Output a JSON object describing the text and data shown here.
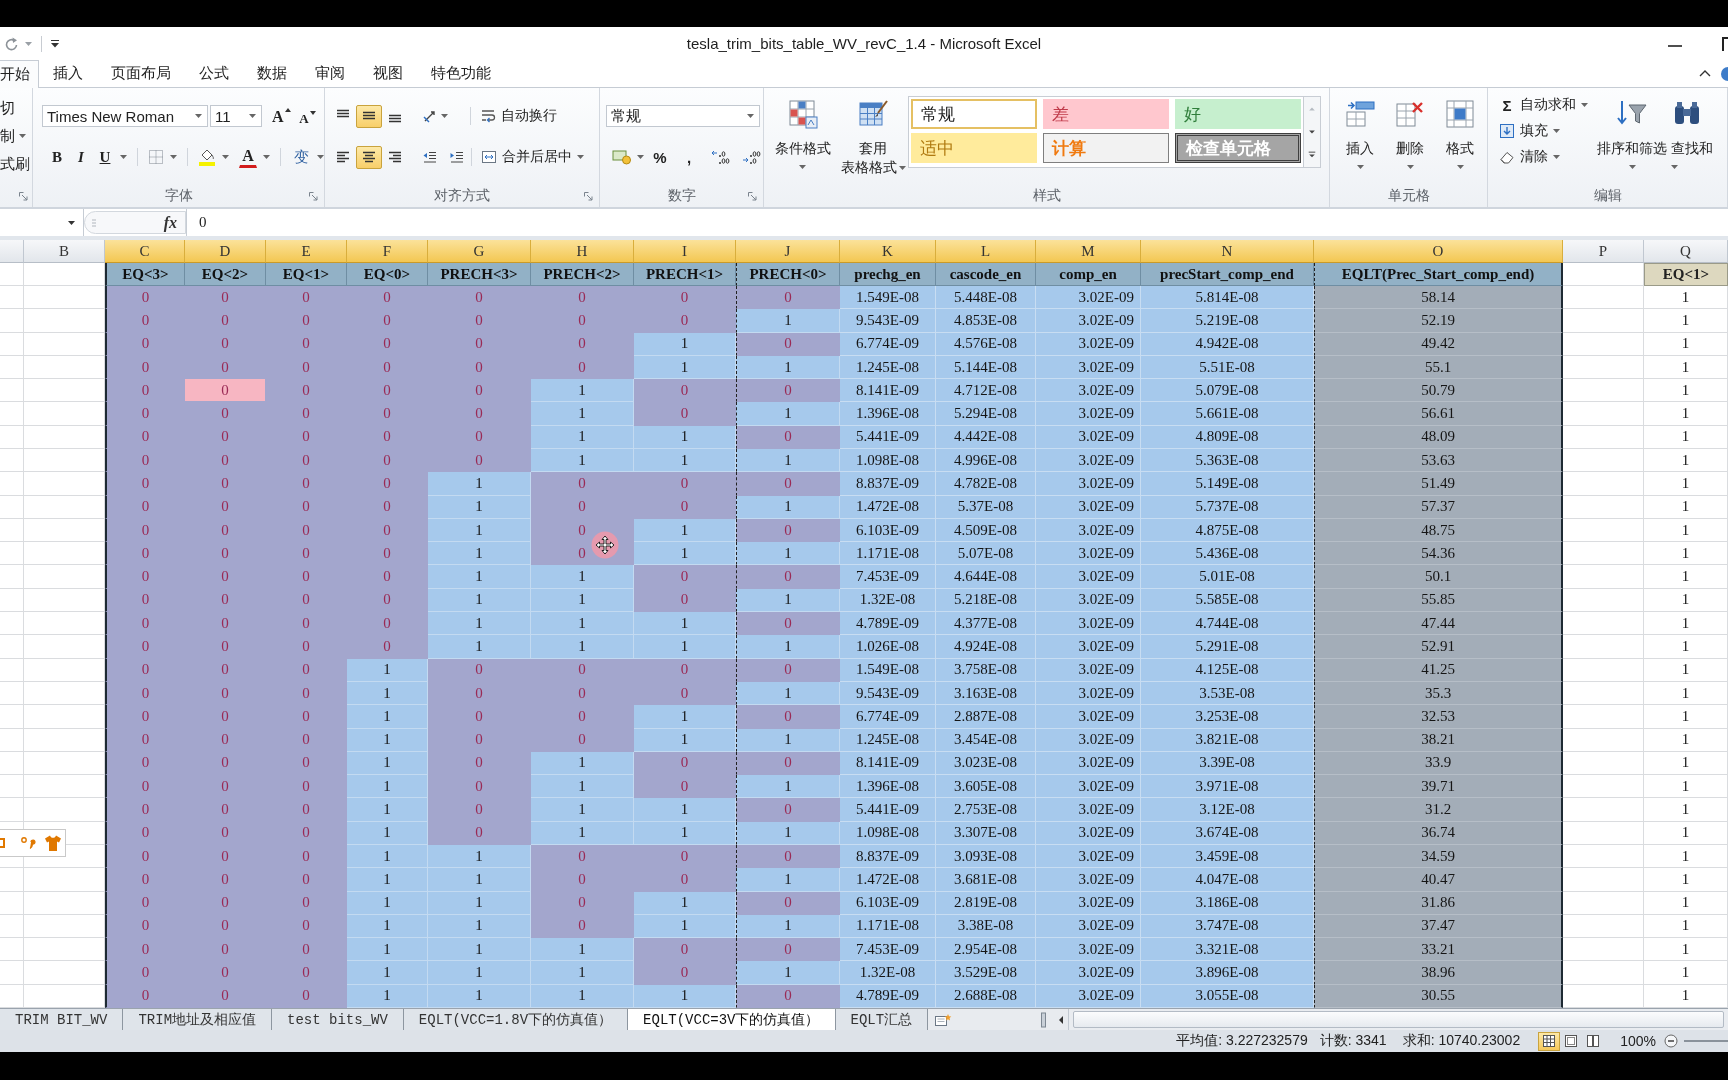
{
  "title_bar": {
    "title": "tesla_trim_bits_table_WV_revC_1.4 - Microsoft Excel"
  },
  "ribbon_tabs": [
    {
      "label": "开始",
      "selected": true
    },
    {
      "label": "插入",
      "selected": false
    },
    {
      "label": "页面布局",
      "selected": false
    },
    {
      "label": "公式",
      "selected": false
    },
    {
      "label": "数据",
      "selected": false
    },
    {
      "label": "审阅",
      "selected": false
    },
    {
      "label": "视图",
      "selected": false
    },
    {
      "label": "特色功能",
      "selected": false
    }
  ],
  "clipboard": {
    "items": [
      "切",
      "制",
      "式刷"
    ]
  },
  "font_group": {
    "font": "Times New Roman",
    "size": "11",
    "grow": "A",
    "shrink": "A",
    "style_buttons": [
      "B",
      "I",
      "U"
    ],
    "color_glyph": "A",
    "phonetic": "变",
    "label": "字体"
  },
  "alignment_group": {
    "vertical": [
      {
        "kind": "top",
        "selected": false
      },
      {
        "kind": "middle",
        "selected": true
      },
      {
        "kind": "bottom",
        "selected": false
      }
    ],
    "horizontal": [
      {
        "kind": "left",
        "selected": false
      },
      {
        "kind": "center",
        "selected": true
      },
      {
        "kind": "right",
        "selected": false
      }
    ],
    "wrap": "自动换行",
    "merge": "合并后居中",
    "label": "对齐方式"
  },
  "number_group": {
    "format": "常规",
    "percent": "%",
    "comma": ",",
    "label": "数字"
  },
  "styles_group": {
    "conditional": "条件格式",
    "table_format": [
      "套用",
      "表格格式"
    ],
    "gallery": [
      {
        "text": "常规",
        "kind": "normal",
        "selected": true
      },
      {
        "text": "差",
        "kind": "bad",
        "selected": false
      },
      {
        "text": "好",
        "kind": "good",
        "selected": false
      },
      {
        "text": "适中",
        "kind": "neutral",
        "selected": false
      },
      {
        "text": "计算",
        "kind": "calculation",
        "selected": false
      },
      {
        "text": "检查单元格",
        "kind": "check",
        "selected": false
      }
    ],
    "label": "样式"
  },
  "cells_group": {
    "buttons": [
      {
        "kind": "insert",
        "label": "插入"
      },
      {
        "kind": "delete",
        "label": "删除"
      },
      {
        "kind": "format",
        "label": "格式"
      }
    ],
    "label": "单元格"
  },
  "editing_group": {
    "autosum": {
      "symbol": "Σ",
      "label": "自动求和"
    },
    "fill": "填充",
    "clear": "清除",
    "sort": "排序和筛选",
    "find": "查找和",
    "label": "编辑"
  },
  "formula_bar": {
    "function_label": "fx",
    "value": "0"
  },
  "sheet": {
    "columns": [
      {
        "letter": "B",
        "selected": false
      },
      {
        "letter": "C",
        "selected": true
      },
      {
        "letter": "D",
        "selected": true
      },
      {
        "letter": "E",
        "selected": true
      },
      {
        "letter": "F",
        "selected": true
      },
      {
        "letter": "G",
        "selected": true
      },
      {
        "letter": "H",
        "selected": true
      },
      {
        "letter": "I",
        "selected": true
      },
      {
        "letter": "J",
        "selected": true
      },
      {
        "letter": "K",
        "selected": true
      },
      {
        "letter": "L",
        "selected": true
      },
      {
        "letter": "M",
        "selected": true
      },
      {
        "letter": "N",
        "selected": true
      },
      {
        "letter": "O",
        "selected": true
      },
      {
        "letter": "P",
        "selected": false
      },
      {
        "letter": "Q",
        "selected": false
      }
    ],
    "header": [
      "EQ<3>",
      "EQ<2>",
      "EQ<1>",
      "EQ<0>",
      "PRECH<3>",
      "PRECH<2>",
      "PRECH<1>",
      "PRECH<0>",
      "prechg_en",
      "cascode_en",
      "comp_en",
      "precStart_comp_end",
      "EQLT(Prec_Start_comp_end)"
    ],
    "q_header": "EQ<1>",
    "rows": [
      {
        "bits": [
          {
            "text": "0",
            "on": false
          },
          {
            "text": "0",
            "on": false
          },
          {
            "text": "0",
            "on": false
          },
          {
            "text": "0",
            "on": false
          },
          {
            "text": "0",
            "on": false
          },
          {
            "text": "0",
            "on": false
          },
          {
            "text": "0",
            "on": false
          },
          {
            "text": "0",
            "on": false
          }
        ],
        "measures": [
          "1.549E-08",
          "5.448E-08",
          "3.02E-09",
          "5.814E-08"
        ],
        "eqlt": "58.14",
        "q": "1"
      },
      {
        "bits": [
          {
            "text": "0",
            "on": false
          },
          {
            "text": "0",
            "on": false
          },
          {
            "text": "0",
            "on": false
          },
          {
            "text": "0",
            "on": false
          },
          {
            "text": "0",
            "on": false
          },
          {
            "text": "0",
            "on": false
          },
          {
            "text": "0",
            "on": false
          },
          {
            "text": "1",
            "on": true
          }
        ],
        "measures": [
          "9.543E-09",
          "4.853E-08",
          "3.02E-09",
          "5.219E-08"
        ],
        "eqlt": "52.19",
        "q": "1"
      },
      {
        "bits": [
          {
            "text": "0",
            "on": false
          },
          {
            "text": "0",
            "on": false
          },
          {
            "text": "0",
            "on": false
          },
          {
            "text": "0",
            "on": false
          },
          {
            "text": "0",
            "on": false
          },
          {
            "text": "0",
            "on": false
          },
          {
            "text": "1",
            "on": true
          },
          {
            "text": "0",
            "on": false
          }
        ],
        "measures": [
          "6.774E-09",
          "4.576E-08",
          "3.02E-09",
          "4.942E-08"
        ],
        "eqlt": "49.42",
        "q": "1"
      },
      {
        "bits": [
          {
            "text": "0",
            "on": false
          },
          {
            "text": "0",
            "on": false
          },
          {
            "text": "0",
            "on": false
          },
          {
            "text": "0",
            "on": false
          },
          {
            "text": "0",
            "on": false
          },
          {
            "text": "0",
            "on": false
          },
          {
            "text": "1",
            "on": true
          },
          {
            "text": "1",
            "on": true
          }
        ],
        "measures": [
          "1.245E-08",
          "5.144E-08",
          "3.02E-09",
          "5.51E-08"
        ],
        "eqlt": "55.1",
        "q": "1"
      },
      {
        "bits": [
          {
            "text": "0",
            "on": false
          },
          {
            "text": "0",
            "on": false,
            "color": "#f7b6c2"
          },
          {
            "text": "0",
            "on": false
          },
          {
            "text": "0",
            "on": false
          },
          {
            "text": "0",
            "on": false
          },
          {
            "text": "1",
            "on": true
          },
          {
            "text": "0",
            "on": false
          },
          {
            "text": "0",
            "on": false
          }
        ],
        "measures": [
          "8.141E-09",
          "4.712E-08",
          "3.02E-09",
          "5.079E-08"
        ],
        "eqlt": "50.79",
        "q": "1"
      },
      {
        "bits": [
          {
            "text": "0",
            "on": false
          },
          {
            "text": "0",
            "on": false
          },
          {
            "text": "0",
            "on": false
          },
          {
            "text": "0",
            "on": false
          },
          {
            "text": "0",
            "on": false
          },
          {
            "text": "1",
            "on": true
          },
          {
            "text": "0",
            "on": false
          },
          {
            "text": "1",
            "on": true
          }
        ],
        "measures": [
          "1.396E-08",
          "5.294E-08",
          "3.02E-09",
          "5.661E-08"
        ],
        "eqlt": "56.61",
        "q": "1"
      },
      {
        "bits": [
          {
            "text": "0",
            "on": false
          },
          {
            "text": "0",
            "on": false
          },
          {
            "text": "0",
            "on": false
          },
          {
            "text": "0",
            "on": false
          },
          {
            "text": "0",
            "on": false
          },
          {
            "text": "1",
            "on": true
          },
          {
            "text": "1",
            "on": true
          },
          {
            "text": "0",
            "on": false
          }
        ],
        "measures": [
          "5.441E-09",
          "4.442E-08",
          "3.02E-09",
          "4.809E-08"
        ],
        "eqlt": "48.09",
        "q": "1"
      },
      {
        "bits": [
          {
            "text": "0",
            "on": false
          },
          {
            "text": "0",
            "on": false
          },
          {
            "text": "0",
            "on": false
          },
          {
            "text": "0",
            "on": false
          },
          {
            "text": "0",
            "on": false
          },
          {
            "text": "1",
            "on": true
          },
          {
            "text": "1",
            "on": true
          },
          {
            "text": "1",
            "on": true
          }
        ],
        "measures": [
          "1.098E-08",
          "4.996E-08",
          "3.02E-09",
          "5.363E-08"
        ],
        "eqlt": "53.63",
        "q": "1"
      },
      {
        "bits": [
          {
            "text": "0",
            "on": false
          },
          {
            "text": "0",
            "on": false
          },
          {
            "text": "0",
            "on": false
          },
          {
            "text": "0",
            "on": false
          },
          {
            "text": "1",
            "on": true
          },
          {
            "text": "0",
            "on": false
          },
          {
            "text": "0",
            "on": false
          },
          {
            "text": "0",
            "on": false
          }
        ],
        "measures": [
          "8.837E-09",
          "4.782E-08",
          "3.02E-09",
          "5.149E-08"
        ],
        "eqlt": "51.49",
        "q": "1"
      },
      {
        "bits": [
          {
            "text": "0",
            "on": false
          },
          {
            "text": "0",
            "on": false
          },
          {
            "text": "0",
            "on": false
          },
          {
            "text": "0",
            "on": false
          },
          {
            "text": "1",
            "on": true
          },
          {
            "text": "0",
            "on": false
          },
          {
            "text": "0",
            "on": false
          },
          {
            "text": "1",
            "on": true
          }
        ],
        "measures": [
          "1.472E-08",
          "5.37E-08",
          "3.02E-09",
          "5.737E-08"
        ],
        "eqlt": "57.37",
        "q": "1"
      },
      {
        "bits": [
          {
            "text": "0",
            "on": false
          },
          {
            "text": "0",
            "on": false
          },
          {
            "text": "0",
            "on": false
          },
          {
            "text": "0",
            "on": false
          },
          {
            "text": "1",
            "on": true
          },
          {
            "text": "0",
            "on": false
          },
          {
            "text": "1",
            "on": true
          },
          {
            "text": "0",
            "on": false
          }
        ],
        "measures": [
          "6.103E-09",
          "4.509E-08",
          "3.02E-09",
          "4.875E-08"
        ],
        "eqlt": "48.75",
        "q": "1"
      },
      {
        "bits": [
          {
            "text": "0",
            "on": false
          },
          {
            "text": "0",
            "on": false
          },
          {
            "text": "0",
            "on": false
          },
          {
            "text": "0",
            "on": false
          },
          {
            "text": "1",
            "on": true
          },
          {
            "text": "0",
            "on": false
          },
          {
            "text": "1",
            "on": true
          },
          {
            "text": "1",
            "on": true
          }
        ],
        "measures": [
          "1.171E-08",
          "5.07E-08",
          "3.02E-09",
          "5.436E-08"
        ],
        "eqlt": "54.36",
        "q": "1"
      },
      {
        "bits": [
          {
            "text": "0",
            "on": false
          },
          {
            "text": "0",
            "on": false
          },
          {
            "text": "0",
            "on": false
          },
          {
            "text": "0",
            "on": false
          },
          {
            "text": "1",
            "on": true
          },
          {
            "text": "1",
            "on": true
          },
          {
            "text": "0",
            "on": false
          },
          {
            "text": "0",
            "on": false
          }
        ],
        "measures": [
          "7.453E-09",
          "4.644E-08",
          "3.02E-09",
          "5.01E-08"
        ],
        "eqlt": "50.1",
        "q": "1"
      },
      {
        "bits": [
          {
            "text": "0",
            "on": false
          },
          {
            "text": "0",
            "on": false
          },
          {
            "text": "0",
            "on": false
          },
          {
            "text": "0",
            "on": false
          },
          {
            "text": "1",
            "on": true
          },
          {
            "text": "1",
            "on": true
          },
          {
            "text": "0",
            "on": false
          },
          {
            "text": "1",
            "on": true
          }
        ],
        "measures": [
          "1.32E-08",
          "5.218E-08",
          "3.02E-09",
          "5.585E-08"
        ],
        "eqlt": "55.85",
        "q": "1"
      },
      {
        "bits": [
          {
            "text": "0",
            "on": false
          },
          {
            "text": "0",
            "on": false
          },
          {
            "text": "0",
            "on": false
          },
          {
            "text": "0",
            "on": false
          },
          {
            "text": "1",
            "on": true
          },
          {
            "text": "1",
            "on": true
          },
          {
            "text": "1",
            "on": true
          },
          {
            "text": "0",
            "on": false
          }
        ],
        "measures": [
          "4.789E-09",
          "4.377E-08",
          "3.02E-09",
          "4.744E-08"
        ],
        "eqlt": "47.44",
        "q": "1"
      },
      {
        "bits": [
          {
            "text": "0",
            "on": false
          },
          {
            "text": "0",
            "on": false
          },
          {
            "text": "0",
            "on": false
          },
          {
            "text": "0",
            "on": false
          },
          {
            "text": "1",
            "on": true
          },
          {
            "text": "1",
            "on": true
          },
          {
            "text": "1",
            "on": true
          },
          {
            "text": "1",
            "on": true
          }
        ],
        "measures": [
          "1.026E-08",
          "4.924E-08",
          "3.02E-09",
          "5.291E-08"
        ],
        "eqlt": "52.91",
        "q": "1"
      },
      {
        "bits": [
          {
            "text": "0",
            "on": false
          },
          {
            "text": "0",
            "on": false
          },
          {
            "text": "0",
            "on": false
          },
          {
            "text": "1",
            "on": true
          },
          {
            "text": "0",
            "on": false
          },
          {
            "text": "0",
            "on": false
          },
          {
            "text": "0",
            "on": false
          },
          {
            "text": "0",
            "on": false
          }
        ],
        "measures": [
          "1.549E-08",
          "3.758E-08",
          "3.02E-09",
          "4.125E-08"
        ],
        "eqlt": "41.25",
        "q": "1"
      },
      {
        "bits": [
          {
            "text": "0",
            "on": false
          },
          {
            "text": "0",
            "on": false
          },
          {
            "text": "0",
            "on": false
          },
          {
            "text": "1",
            "on": true
          },
          {
            "text": "0",
            "on": false
          },
          {
            "text": "0",
            "on": false
          },
          {
            "text": "0",
            "on": false
          },
          {
            "text": "1",
            "on": true
          }
        ],
        "measures": [
          "9.543E-09",
          "3.163E-08",
          "3.02E-09",
          "3.53E-08"
        ],
        "eqlt": "35.3",
        "q": "1"
      },
      {
        "bits": [
          {
            "text": "0",
            "on": false
          },
          {
            "text": "0",
            "on": false
          },
          {
            "text": "0",
            "on": false
          },
          {
            "text": "1",
            "on": true
          },
          {
            "text": "0",
            "on": false
          },
          {
            "text": "0",
            "on": false
          },
          {
            "text": "1",
            "on": true
          },
          {
            "text": "0",
            "on": false
          }
        ],
        "measures": [
          "6.774E-09",
          "2.887E-08",
          "3.02E-09",
          "3.253E-08"
        ],
        "eqlt": "32.53",
        "q": "1"
      },
      {
        "bits": [
          {
            "text": "0",
            "on": false
          },
          {
            "text": "0",
            "on": false
          },
          {
            "text": "0",
            "on": false
          },
          {
            "text": "1",
            "on": true
          },
          {
            "text": "0",
            "on": false
          },
          {
            "text": "0",
            "on": false
          },
          {
            "text": "1",
            "on": true
          },
          {
            "text": "1",
            "on": true
          }
        ],
        "measures": [
          "1.245E-08",
          "3.454E-08",
          "3.02E-09",
          "3.821E-08"
        ],
        "eqlt": "38.21",
        "q": "1"
      },
      {
        "bits": [
          {
            "text": "0",
            "on": false
          },
          {
            "text": "0",
            "on": false
          },
          {
            "text": "0",
            "on": false
          },
          {
            "text": "1",
            "on": true
          },
          {
            "text": "0",
            "on": false
          },
          {
            "text": "1",
            "on": true
          },
          {
            "text": "0",
            "on": false
          },
          {
            "text": "0",
            "on": false
          }
        ],
        "measures": [
          "8.141E-09",
          "3.023E-08",
          "3.02E-09",
          "3.39E-08"
        ],
        "eqlt": "33.9",
        "q": "1"
      },
      {
        "bits": [
          {
            "text": "0",
            "on": false
          },
          {
            "text": "0",
            "on": false
          },
          {
            "text": "0",
            "on": false
          },
          {
            "text": "1",
            "on": true
          },
          {
            "text": "0",
            "on": false
          },
          {
            "text": "1",
            "on": true
          },
          {
            "text": "0",
            "on": false
          },
          {
            "text": "1",
            "on": true
          }
        ],
        "measures": [
          "1.396E-08",
          "3.605E-08",
          "3.02E-09",
          "3.971E-08"
        ],
        "eqlt": "39.71",
        "q": "1"
      },
      {
        "bits": [
          {
            "text": "0",
            "on": false
          },
          {
            "text": "0",
            "on": false
          },
          {
            "text": "0",
            "on": false
          },
          {
            "text": "1",
            "on": true
          },
          {
            "text": "0",
            "on": false
          },
          {
            "text": "1",
            "on": true
          },
          {
            "text": "1",
            "on": true
          },
          {
            "text": "0",
            "on": false
          }
        ],
        "measures": [
          "5.441E-09",
          "2.753E-08",
          "3.02E-09",
          "3.12E-08"
        ],
        "eqlt": "31.2",
        "q": "1"
      },
      {
        "bits": [
          {
            "text": "0",
            "on": false
          },
          {
            "text": "0",
            "on": false
          },
          {
            "text": "0",
            "on": false
          },
          {
            "text": "1",
            "on": true
          },
          {
            "text": "0",
            "on": false
          },
          {
            "text": "1",
            "on": true
          },
          {
            "text": "1",
            "on": true
          },
          {
            "text": "1",
            "on": true
          }
        ],
        "measures": [
          "1.098E-08",
          "3.307E-08",
          "3.02E-09",
          "3.674E-08"
        ],
        "eqlt": "36.74",
        "q": "1"
      },
      {
        "bits": [
          {
            "text": "0",
            "on": false
          },
          {
            "text": "0",
            "on": false
          },
          {
            "text": "0",
            "on": false
          },
          {
            "text": "1",
            "on": true
          },
          {
            "text": "1",
            "on": true
          },
          {
            "text": "0",
            "on": false
          },
          {
            "text": "0",
            "on": false
          },
          {
            "text": "0",
            "on": false
          }
        ],
        "measures": [
          "8.837E-09",
          "3.093E-08",
          "3.02E-09",
          "3.459E-08"
        ],
        "eqlt": "34.59",
        "q": "1"
      },
      {
        "bits": [
          {
            "text": "0",
            "on": false
          },
          {
            "text": "0",
            "on": false
          },
          {
            "text": "0",
            "on": false
          },
          {
            "text": "1",
            "on": true
          },
          {
            "text": "1",
            "on": true
          },
          {
            "text": "0",
            "on": false
          },
          {
            "text": "0",
            "on": false
          },
          {
            "text": "1",
            "on": true
          }
        ],
        "measures": [
          "1.472E-08",
          "3.681E-08",
          "3.02E-09",
          "4.047E-08"
        ],
        "eqlt": "40.47",
        "q": "1"
      },
      {
        "bits": [
          {
            "text": "0",
            "on": false
          },
          {
            "text": "0",
            "on": false
          },
          {
            "text": "0",
            "on": false
          },
          {
            "text": "1",
            "on": true
          },
          {
            "text": "1",
            "on": true
          },
          {
            "text": "0",
            "on": false
          },
          {
            "text": "1",
            "on": true
          },
          {
            "text": "0",
            "on": false
          }
        ],
        "measures": [
          "6.103E-09",
          "2.819E-08",
          "3.02E-09",
          "3.186E-08"
        ],
        "eqlt": "31.86",
        "q": "1"
      },
      {
        "bits": [
          {
            "text": "0",
            "on": false
          },
          {
            "text": "0",
            "on": false
          },
          {
            "text": "0",
            "on": false
          },
          {
            "text": "1",
            "on": true
          },
          {
            "text": "1",
            "on": true
          },
          {
            "text": "0",
            "on": false
          },
          {
            "text": "1",
            "on": true
          },
          {
            "text": "1",
            "on": true
          }
        ],
        "measures": [
          "1.171E-08",
          "3.38E-08",
          "3.02E-09",
          "3.747E-08"
        ],
        "eqlt": "37.47",
        "q": "1"
      },
      {
        "bits": [
          {
            "text": "0",
            "on": false
          },
          {
            "text": "0",
            "on": false
          },
          {
            "text": "0",
            "on": false
          },
          {
            "text": "1",
            "on": true
          },
          {
            "text": "1",
            "on": true
          },
          {
            "text": "1",
            "on": true
          },
          {
            "text": "0",
            "on": false
          },
          {
            "text": "0",
            "on": false
          }
        ],
        "measures": [
          "7.453E-09",
          "2.954E-08",
          "3.02E-09",
          "3.321E-08"
        ],
        "eqlt": "33.21",
        "q": "1"
      },
      {
        "bits": [
          {
            "text": "0",
            "on": false
          },
          {
            "text": "0",
            "on": false
          },
          {
            "text": "0",
            "on": false
          },
          {
            "text": "1",
            "on": true
          },
          {
            "text": "1",
            "on": true
          },
          {
            "text": "1",
            "on": true
          },
          {
            "text": "0",
            "on": false
          },
          {
            "text": "1",
            "on": true
          }
        ],
        "measures": [
          "1.32E-08",
          "3.529E-08",
          "3.02E-09",
          "3.896E-08"
        ],
        "eqlt": "38.96",
        "q": "1"
      },
      {
        "bits": [
          {
            "text": "0",
            "on": false
          },
          {
            "text": "0",
            "on": false
          },
          {
            "text": "0",
            "on": false
          },
          {
            "text": "1",
            "on": true
          },
          {
            "text": "1",
            "on": true
          },
          {
            "text": "1",
            "on": true
          },
          {
            "text": "1",
            "on": true
          },
          {
            "text": "0",
            "on": false
          }
        ],
        "measures": [
          "4.789E-09",
          "2.688E-08",
          "3.02E-09",
          "3.055E-08"
        ],
        "eqlt": "30.55",
        "q": "1"
      }
    ]
  },
  "sheet_tabs": [
    {
      "label": "TRIM BIT_WV",
      "selected": false
    },
    {
      "label": "TRIM地址及相应值",
      "selected": false
    },
    {
      "label": "test bits_WV",
      "selected": false
    },
    {
      "label": "EQLT(VCC=1.8V下的仿真值）",
      "selected": false
    },
    {
      "label": "EQLT(VCC=3V下的仿真值）",
      "selected": true
    },
    {
      "label": "EQLT汇总",
      "selected": false
    }
  ],
  "status_bar": {
    "average": "平均值: 3.227232579",
    "count": "计数: 3341",
    "sum": "求和: 10740.23002",
    "views": [
      {
        "kind": "normal",
        "selected": true
      },
      {
        "kind": "page-layout",
        "selected": false
      },
      {
        "kind": "page-break",
        "selected": false
      }
    ],
    "zoom": "100%"
  }
}
